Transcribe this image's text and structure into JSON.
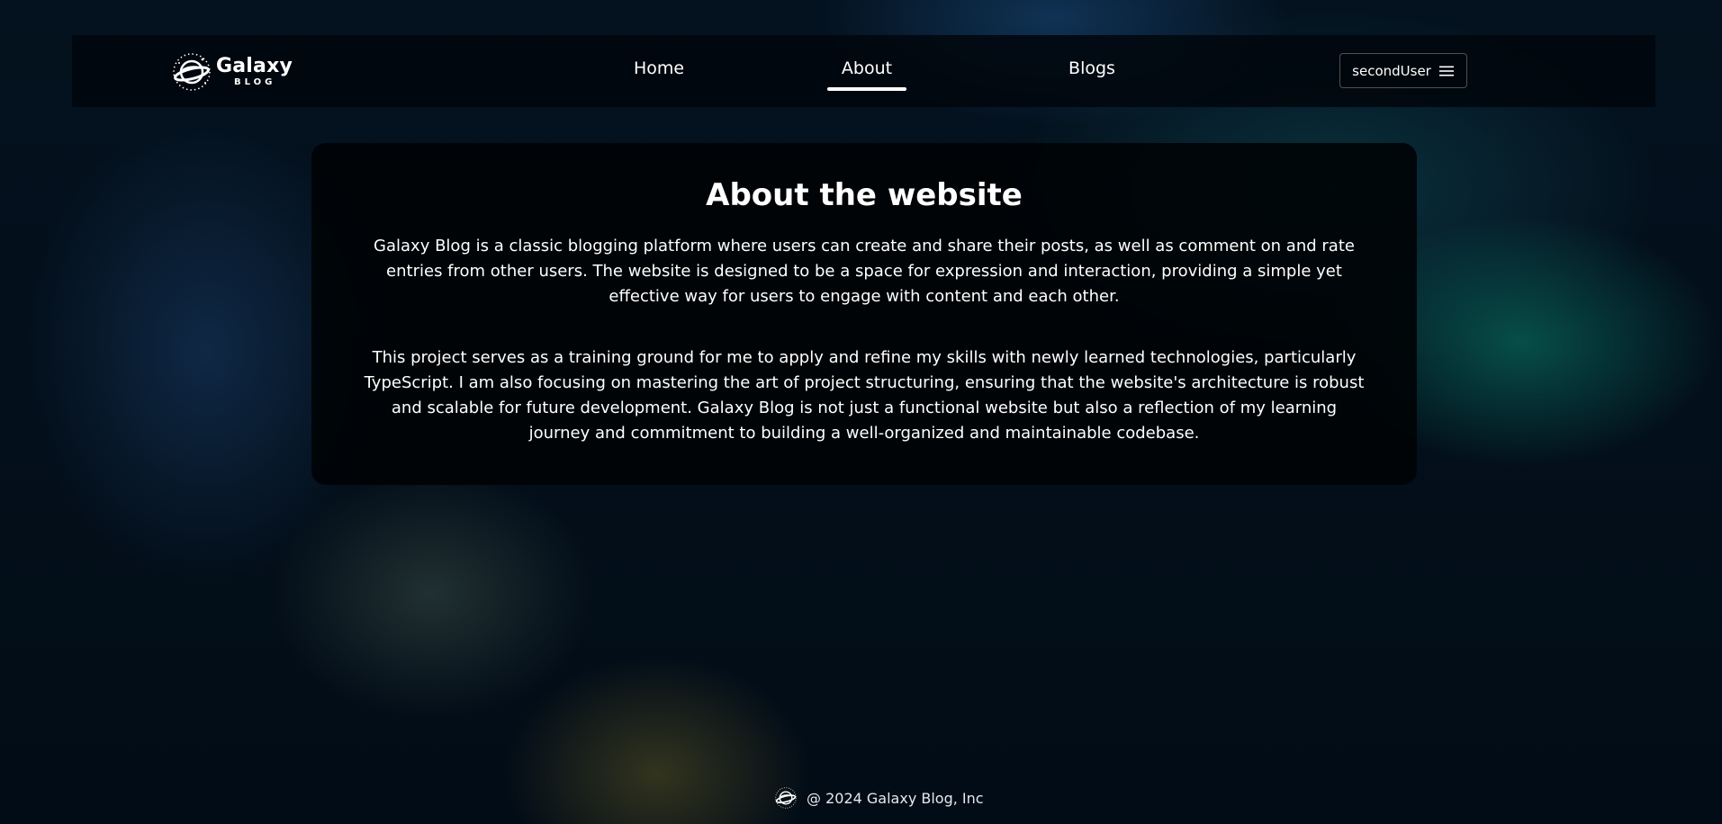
{
  "header": {
    "logo": {
      "title": "Galaxy",
      "subtitle": "BLOG",
      "icon": "planet-icon"
    },
    "nav": [
      {
        "label": "Home",
        "active": false
      },
      {
        "label": "About",
        "active": true
      },
      {
        "label": "Blogs",
        "active": false
      }
    ],
    "user_menu": {
      "username": "secondUser",
      "icon": "menu-icon"
    }
  },
  "main": {
    "title": "About the website",
    "paragraphs": [
      "Galaxy Blog is a classic blogging platform where users can create and share their posts, as well as comment on and rate entries from other users. The website is designed to be a space for expression and interaction, providing a simple yet effective way for users to engage with content and each other.",
      "This project serves as a training ground for me to apply and refine my skills with newly learned technologies, particularly TypeScript. I am also focusing on mastering the art of project structuring, ensuring that the website's architecture is robust and scalable for future development. Galaxy Blog is not just a functional website but also a reflection of my learning journey and commitment to building a well-organized and maintainable codebase."
    ]
  },
  "footer": {
    "text": "@ 2024 Galaxy Blog, Inc",
    "icon": "planet-icon"
  },
  "colors": {
    "background": "#030e18",
    "navbar": "#01060c",
    "card": "#000306",
    "text": "#ffffff",
    "button_border": "#4a5157"
  }
}
